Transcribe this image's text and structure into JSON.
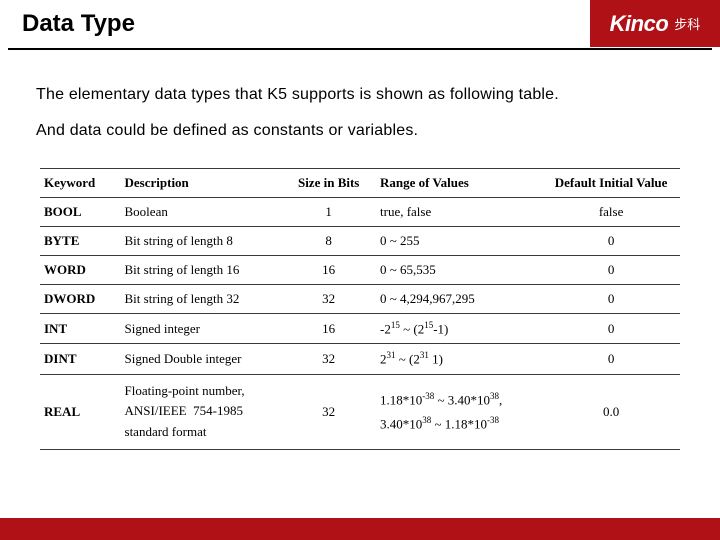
{
  "brand": {
    "name": "Kinco",
    "cn": "步科"
  },
  "title": "Data Type",
  "paragraphs": {
    "p1": "The elementary data types that K5 supports is shown as following table.",
    "p2": "And data could be defined as constants or variables."
  },
  "table": {
    "headers": {
      "keyword": "Keyword",
      "description": "Description",
      "size": "Size in Bits",
      "range": "Range of Values",
      "default": "Default Initial Value"
    },
    "rows": [
      {
        "keyword": "BOOL",
        "description": "Boolean",
        "size": "1",
        "range": "true, false",
        "default": "false"
      },
      {
        "keyword": "BYTE",
        "description": "Bit string of length 8",
        "size": "8",
        "range": "0 ~ 255",
        "default": "0"
      },
      {
        "keyword": "WORD",
        "description": "Bit string of length 16",
        "size": "16",
        "range": "0 ~ 65,535",
        "default": "0"
      },
      {
        "keyword": "DWORD",
        "description": "Bit string of length 32",
        "size": "32",
        "range": "0 ~ 4,294,967,295",
        "default": "0"
      },
      {
        "keyword": "INT",
        "description": "Signed integer",
        "size": "16",
        "range": "-2^15 ~ (2^15 - 1)",
        "default": "0"
      },
      {
        "keyword": "DINT",
        "description": "Signed Double integer",
        "size": "32",
        "range": "2^31 ~ (2^31 - 1)",
        "default": "0"
      },
      {
        "keyword": "REAL",
        "description": "Floating-point number, ANSI/IEEE 754-1985 standard format",
        "size": "32",
        "range": "1.18*10^-38 ~ 3.40*10^38, 3.40*10^38 ~ 1.18*10^-38",
        "default": "0.0"
      }
    ],
    "real_range_html": "1.18*10<sup>-38</sup> ~ 3.40*10<sup>38</sup>,<br>3.40*10<sup>38</sup> ~ 1.18*10<sup>-38</sup>",
    "int_range_html": "-2<sup>15</sup> ~ (2<sup>15</sup>-1)",
    "dint_range_html": "2<sup>31</sup> ~ (2<sup>31</sup> 1)"
  }
}
